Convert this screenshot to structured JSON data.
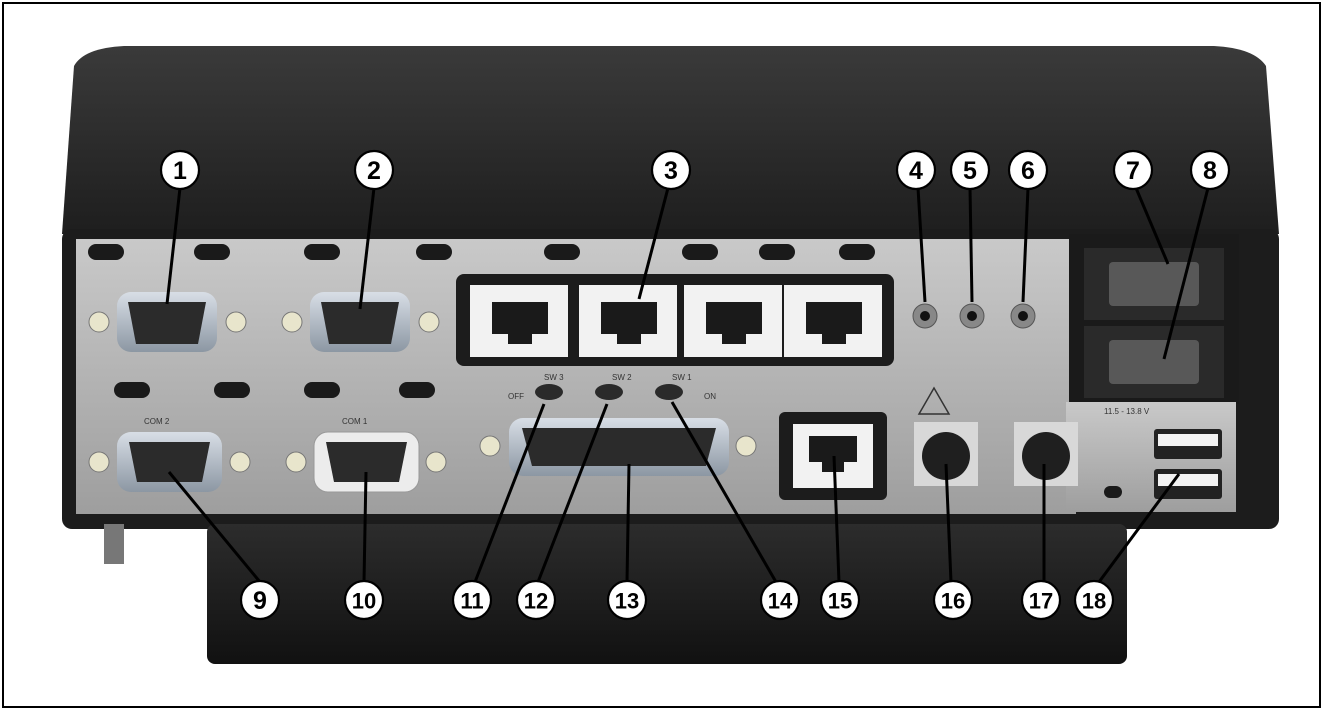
{
  "callouts": [
    {
      "label": "1",
      "text": "1"
    },
    {
      "label": "2",
      "text": "2"
    },
    {
      "label": "3",
      "text": "3"
    },
    {
      "label": "4",
      "text": "4"
    },
    {
      "label": "5",
      "text": "5"
    },
    {
      "label": "6",
      "text": "6"
    },
    {
      "label": "7",
      "text": "7"
    },
    {
      "label": "8",
      "text": "8"
    },
    {
      "label": "9",
      "text": "9"
    },
    {
      "label": "10",
      "text": "10"
    },
    {
      "label": "11",
      "text": "11"
    },
    {
      "label": "12",
      "text": "12"
    },
    {
      "label": "13",
      "text": "13"
    },
    {
      "label": "14",
      "text": "14"
    },
    {
      "label": "15",
      "text": "15"
    },
    {
      "label": "16",
      "text": "16"
    },
    {
      "label": "17",
      "text": "17"
    },
    {
      "label": "18",
      "text": "18"
    }
  ],
  "panel_labels": {
    "com2": "COM 2",
    "com1": "COM 1",
    "sw3": "SW 3",
    "sw2": "SW 2",
    "sw1": "SW 1",
    "off": "OFF",
    "on": "ON",
    "power_rating": "11.5 - 13.8 V"
  },
  "colors": {
    "chassis": "#262626",
    "panel": "#b3b3b3",
    "callout_fill": "#ffffff",
    "callout_stroke": "#000000"
  }
}
